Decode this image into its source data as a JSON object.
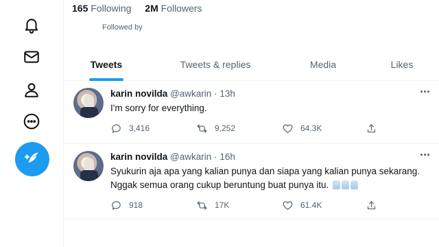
{
  "profile": {
    "following_count": "165",
    "following_label": "Following",
    "followers_count": "2M",
    "followers_label": "Followers",
    "followed_by": "Followed by"
  },
  "nav": {
    "items": [
      "notifications-icon",
      "messages-icon",
      "profile-icon",
      "more-icon"
    ],
    "compose": "compose-icon",
    "accent": "#1d9bf0"
  },
  "tabs": [
    {
      "label": "Tweets",
      "active": true
    },
    {
      "label": "Tweets & replies",
      "active": false
    },
    {
      "label": "Media",
      "active": false
    },
    {
      "label": "Likes",
      "active": false
    }
  ],
  "tweets": [
    {
      "name": "karin novilda",
      "handle": "@awkarin",
      "dot": "·",
      "time": "13h",
      "text": "I'm sorry for everything.",
      "replies": "3,416",
      "retweets": "9,252",
      "likes": "64.3K"
    },
    {
      "name": "karin novilda",
      "handle": "@awkarin",
      "dot": "·",
      "time": "16h",
      "text_line1": "Syukurin aja apa yang kalian punya dan siapa yang kalian punya sekarang.",
      "text_line2": "Nggak semua orang cukup beruntung buat punya itu.",
      "emoji": "praying-hands-emoji x3",
      "replies": "918",
      "retweets": "17K",
      "likes": "61.4K"
    }
  ]
}
